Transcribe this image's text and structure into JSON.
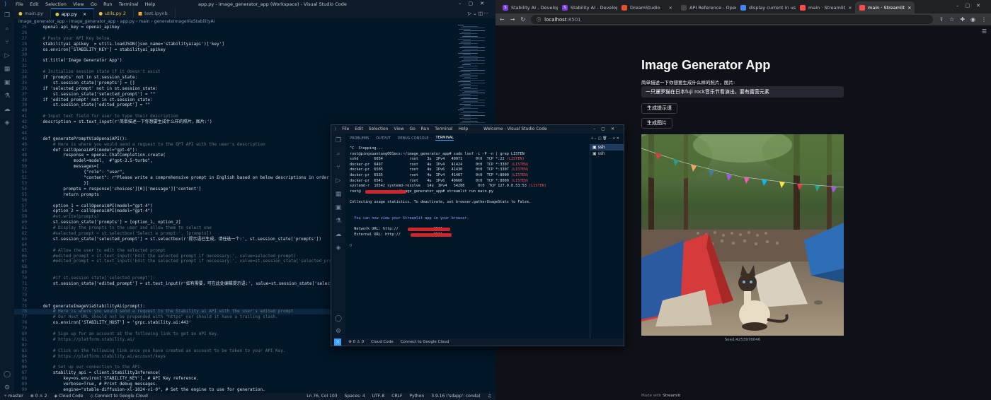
{
  "vscode": {
    "window_title": "app.py - image_generator_app (Workspace) - Visual Studio Code",
    "menu": [
      "File",
      "Edit",
      "Selection",
      "View",
      "Go",
      "Run",
      "Terminal",
      "Help"
    ],
    "tabs": [
      {
        "label": "main.py"
      },
      {
        "label": "app.py"
      },
      {
        "label": "utils.py  2"
      },
      {
        "label": "test.ipynb"
      }
    ],
    "breadcrumb": "image_generator_app  ›  image_generator_app  ›  app.py  ›  main  ›  generateImageViaStabilityAi",
    "code": [
      {
        "n": "25",
        "t": "    openai.api_key = openai_apikey",
        "c": false
      },
      {
        "n": "26",
        "t": "",
        "c": false
      },
      {
        "n": "27",
        "t": "    # Paste your API Key below.",
        "c": true
      },
      {
        "n": "28",
        "t": "    stabilityai_apikey  = utils.loadJSON(json_name='stabilityaiapi')['key']",
        "c": false
      },
      {
        "n": "29",
        "t": "    os.environ['STABILITY_KEY'] = stabilityai_apikey",
        "c": false
      },
      {
        "n": "30",
        "t": "",
        "c": false
      },
      {
        "n": "31",
        "t": "    st.title('Image Generator App')",
        "c": false
      },
      {
        "n": "32",
        "t": "",
        "c": false
      },
      {
        "n": "33",
        "t": "    # Initialize session state if it doesn't exist",
        "c": true
      },
      {
        "n": "34",
        "t": "    if 'prompts' not in st.session_state:",
        "c": false
      },
      {
        "n": "35",
        "t": "        st.session_state['prompts'] = []",
        "c": false
      },
      {
        "n": "36",
        "t": "    if 'selected_prompt' not in st.session_state:",
        "c": false
      },
      {
        "n": "37",
        "t": "        st.session_state['selected_prompt'] = \"\"",
        "c": false
      },
      {
        "n": "38",
        "t": "    if 'edited_prompt' not in st.session_state:",
        "c": false
      },
      {
        "n": "39",
        "t": "        st.session_state['edited_prompt'] = \"\"",
        "c": false
      },
      {
        "n": "40",
        "t": "",
        "c": false
      },
      {
        "n": "41",
        "t": "    # Input text field for user to type their description",
        "c": true
      },
      {
        "n": "42",
        "t": "    description = st.text_input(r'简单描述一下你想要生成什么样的照片，图片:')",
        "c": false
      },
      {
        "n": "43",
        "t": "",
        "c": false
      },
      {
        "n": "44",
        "t": "",
        "c": false
      },
      {
        "n": "45",
        "t": "    def generatePromptViaOpenaiAPI():",
        "c": false
      },
      {
        "n": "46",
        "t": "        # Here is where you would send a request to the GPT API with the user's description",
        "c": true
      },
      {
        "n": "47",
        "t": "        def callOpenaiAPI(model=\"gpt-4\"):",
        "c": false
      },
      {
        "n": "48",
        "t": "            response = openai.ChatCompletion.create(",
        "c": false
      },
      {
        "n": "49",
        "t": "                model=model,  #\"gpt-3.5-turbo\",",
        "c": false
      },
      {
        "n": "50",
        "t": "                messages=[",
        "c": false
      },
      {
        "n": "51",
        "t": "                    {\"role\": \"user\",",
        "c": false
      },
      {
        "n": "52",
        "t": "                    \"content\": r\"Please write a comprehensive prompt in English based on below descriptions in order to generate a high qu",
        "c": false
      },
      {
        "n": "53",
        "t": "                    }]",
        "c": false
      },
      {
        "n": "54",
        "t": "            prompts = response['choices'][0]['message']['content']",
        "c": false
      },
      {
        "n": "55",
        "t": "            return prompts",
        "c": false
      },
      {
        "n": "56",
        "t": "",
        "c": false
      },
      {
        "n": "57",
        "t": "        option_1 = callOpenaiAPI(model=\"gpt-4\")",
        "c": false
      },
      {
        "n": "58",
        "t": "        option_2 = callOpenaiAPI(model=\"gpt-4\")",
        "c": false
      },
      {
        "n": "59",
        "t": "        #st.write(prompts)",
        "c": true
      },
      {
        "n": "60",
        "t": "        st.session_state['prompts'] = [option_1, option_2]",
        "c": false
      },
      {
        "n": "61",
        "t": "        # Display the prompts to the user and allow them to select one",
        "c": true
      },
      {
        "n": "62",
        "t": "        #selected_prompt = st.selectbox('Select a prompt:', [prompts])",
        "c": true
      },
      {
        "n": "63",
        "t": "        st.session_state['selected_prompt'] = st.selectbox(r'提示语已生成，请任选一个:', st.session_state['prompts'])",
        "c": false
      },
      {
        "n": "64",
        "t": "",
        "c": false
      },
      {
        "n": "65",
        "t": "        # Allow the user to edit the selected prompt",
        "c": true
      },
      {
        "n": "66",
        "t": "        #edited_prompt = st.text_input('Edit the selected prompt if necessary:', value=selected_prompt)",
        "c": true
      },
      {
        "n": "67",
        "t": "        #edited_prompt = st.text_input('Edit the selected prompt if necessary:', value=st.session_state['selected_prompt'])",
        "c": true
      },
      {
        "n": "68",
        "t": "",
        "c": false
      },
      {
        "n": "69",
        "t": "",
        "c": false
      },
      {
        "n": "70",
        "t": "        #if st.session_state['selected_prompt']:",
        "c": true
      },
      {
        "n": "71",
        "t": "        st.session_state['edited_prompt'] = st.text_input(r'如有需要，可在此处编辑提示语:', value=st.session_state['selected_prompt'])",
        "c": false
      },
      {
        "n": "72",
        "t": "",
        "c": false
      },
      {
        "n": "73",
        "t": "",
        "c": false
      },
      {
        "n": "74",
        "t": "",
        "c": false
      },
      {
        "n": "75",
        "t": "    def generateImageViaStabilityAi(prompt):",
        "c": false
      },
      {
        "n": "76",
        "t": "        # Here is where you would send a request to the Stability.ai API with the user's edited prompt",
        "c": true
      },
      {
        "n": "77",
        "t": "        # Our Host URL should not be prepended with \"https\" nor should it have a trailing slash.",
        "c": true
      },
      {
        "n": "78",
        "t": "        os.environ['STABILITY_HOST'] = 'grpc.stability.ai:443'",
        "c": false
      },
      {
        "n": "79",
        "t": "",
        "c": false
      },
      {
        "n": "80",
        "t": "        # Sign up for an account at the following link to get an API Key.",
        "c": true
      },
      {
        "n": "81",
        "t": "        # https://platform.stability.ai/",
        "c": true
      },
      {
        "n": "82",
        "t": "",
        "c": false
      },
      {
        "n": "83",
        "t": "        # Click on the following link once you have created an account to be taken to your API Key.",
        "c": true
      },
      {
        "n": "84",
        "t": "        # https://platform.stability.ai/account/keys",
        "c": true
      },
      {
        "n": "85",
        "t": "",
        "c": false
      },
      {
        "n": "86",
        "t": "        # Set up our connection to the API.",
        "c": true
      },
      {
        "n": "87",
        "t": "        stability_api = client.StabilityInference(",
        "c": false
      },
      {
        "n": "88",
        "t": "            key=os.environ['STABILITY_KEY'], # API Key reference.",
        "c": false
      },
      {
        "n": "89",
        "t": "            verbose=True, # Print debug messages.",
        "c": false
      },
      {
        "n": "90",
        "t": "            engine=\"stable-diffusion-xl-1024-v1-0\", # Set the engine to use for generation.",
        "c": false
      },
      {
        "n": "91",
        "t": "            # Check out the following link for a list of available engines: https://platform.stability.ai/docs/features/api-parameters#engine",
        "c": true
      }
    ],
    "status_left": [
      "master",
      "⊗ 0 ⚠ 2",
      "Cloud Code",
      "Connect to Google Cloud"
    ],
    "status_right": [
      "Ln 76, Col 103",
      "Spaces: 4",
      "UTF-8",
      "CRLF",
      "Python",
      "3.9.16 ('sdapp': conda)"
    ]
  },
  "browser": {
    "tabs": [
      {
        "label": "Stability AI - Developer",
        "color": "#7b3fe4",
        "glyph": "S"
      },
      {
        "label": "Stability AI - Developer",
        "color": "#7b3fe4",
        "glyph": "S"
      },
      {
        "label": "DreamStudio",
        "color": "#e24d2a",
        "glyph": ""
      },
      {
        "label": "API Reference - OpenAI",
        "color": "#444444",
        "glyph": ""
      },
      {
        "label": "display current in use p",
        "color": "#4285f4",
        "glyph": ""
      },
      {
        "label": "main · Streamlit",
        "color": "#ff4b4b",
        "glyph": ""
      },
      {
        "label": "main · Streamlit",
        "color": "#ff4b4b",
        "glyph": ""
      }
    ],
    "url_host": "localhost",
    "url_port": ":8501",
    "app": {
      "title": "Image Generator App",
      "label": "简单描述一下你想要生成什么样的照片，图片:",
      "input_value": "一只暹罗猫在日本fuji rock音乐节看演出，要有露营元素",
      "btn_prompt": "生成提示语",
      "btn_image": "生成图片",
      "caption": "Seed:4253978046",
      "footer_prefix": "Made with ",
      "footer_brand": "Streamlit"
    }
  },
  "float_vscode": {
    "title": "Welcome - Visual Studio Code",
    "menu": [
      "File",
      "Edit",
      "Selection",
      "View",
      "Go",
      "Run",
      "Terminal",
      "Help"
    ],
    "panel_tabs": [
      "PROBLEMS",
      "OUTPUT",
      "DEBUG CONSOLE",
      "TERMINAL"
    ],
    "terminal_lines": [
      "^C  Stopping...",
      "root@pingsuantang001ecs:~/image_generator_app# sudo lsof -i -P -n | grep LISTEN",
      "sshd       6034            root    3u  IPv4   40971      0t0  TCP *:22 (LISTEN)",
      "docker-pr  6497            root    4u  IPv4   41424      0t0  TCP *:3307 (LISTEN)",
      "docker-pr  6505            root    4u  IPv6   41430      0t0  TCP *:3307 (LISTEN)",
      "docker-pr  6535            root    4u  IPv4   41467      0t0  TCP *:8000 (LISTEN)",
      "docker-pr  6541            root    4u  IPv6   40660      0t0  TCP *:8000 (LISTEN)",
      "systemd-r  16542 systemd-resolve   14u  IPv4   54288      0t0  TCP 127.0.0.53:53 (LISTEN)",
      "root@               :~/image_generator_app# streamlit run main.py",
      "",
      "Collecting usage statistics. To deactivate, set browser.gatherUsageStats to False.",
      "",
      "",
      "  You can now view your Streamlit app in your browser.",
      "",
      "  Network URL: http://               :8501",
      "  External URL: http://              :8501",
      "",
      "▯"
    ],
    "shells": [
      "ssh",
      "ssh"
    ],
    "status": [
      "⊗ 0 ⚠ 0",
      "Cloud Code",
      "Connect to Google Cloud"
    ]
  }
}
